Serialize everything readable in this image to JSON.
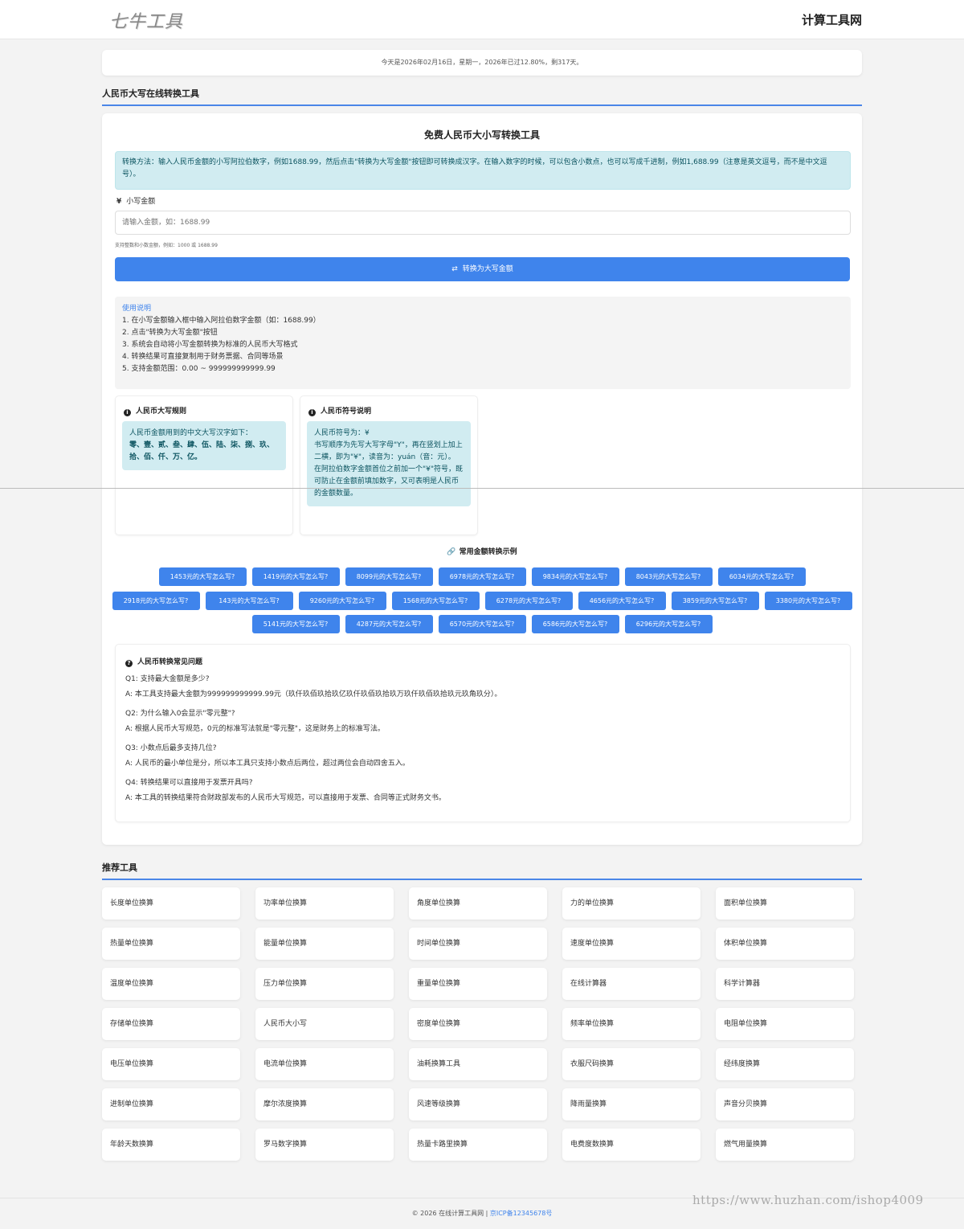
{
  "header": {
    "logo": "七牛工具",
    "site_name": "计算工具网"
  },
  "date_bar": "今天是2026年02月16日，星期一，2026年已过12.80%，剩317天。",
  "tool_section": {
    "heading": "人民币大写在线转换工具"
  },
  "converter": {
    "title": "免费人民币大小写转换工具",
    "tip": "转换方法：输入人民币金额的小写阿拉伯数字，例如1688.99，然后点击\"转换为大写金额\"按钮即可转换成汉字。在输入数字的时候，可以包含小数点，也可以写成千进制，例如1,688.99（注意是英文逗号，而不是中文逗号）。",
    "label_icon": "¥",
    "label": "小写金额",
    "placeholder": "请输入金额，如：1688.99",
    "hint": "支持整数和小数金额，例如：1000 或 1688.99",
    "button_icon": "⇄",
    "button_label": "转换为大写金额"
  },
  "usage": {
    "title": "使用说明",
    "items": [
      "1. 在小写金额输入框中输入阿拉伯数字金额（如：1688.99）",
      "2. 点击\"转换为大写金额\"按钮",
      "3. 系统会自动将小写金额转换为标准的人民币大写格式",
      "4. 转换结果可直接复制用于财务票据、合同等场景",
      "5. 支持金额范围：0.00 ~ 999999999999.99"
    ]
  },
  "rules": {
    "title": "人民币大写规则",
    "intro": "人民币金额用到的中文大写汉字如下：",
    "chars": "零、壹、贰、叁、肆、伍、陆、柒、捌、玖、拾、佰、仟、万、亿。"
  },
  "symbol": {
    "title": "人民币符号说明",
    "line1": "人民币符号为：¥",
    "line2": "书写顺序为先写大写字母\"Y\"，再在竖划上加上二横，即为\"¥\"，读音为：yuán（音：元）。",
    "line3": "在阿拉伯数字金额首位之前加一个\"¥\"符号，既可防止在金额前填加数字，又可表明是人民币的金额数量。"
  },
  "examples": {
    "icon": "🔗",
    "title": "常用金额转换示例",
    "rows": [
      [
        "1453元的大写怎么写?",
        "1419元的大写怎么写?",
        "8099元的大写怎么写?",
        "6978元的大写怎么写?",
        "9834元的大写怎么写?",
        "8043元的大写怎么写?",
        "6034元的大写怎么写?"
      ],
      [
        "2918元的大写怎么写?",
        "143元的大写怎么写?",
        "9260元的大写怎么写?",
        "1568元的大写怎么写?",
        "6278元的大写怎么写?",
        "4656元的大写怎么写?",
        "3859元的大写怎么写?",
        "3380元的大写怎么写?"
      ],
      [
        "5141元的大写怎么写?",
        "4287元的大写怎么写?",
        "6570元的大写怎么写?",
        "6586元的大写怎么写?",
        "6296元的大写怎么写?"
      ]
    ]
  },
  "faq": {
    "title": "人民币转换常见问题",
    "items": [
      {
        "q": "Q1: 支持最大金额是多少?",
        "a": "A: 本工具支持最大金额为999999999999.99元（玖仟玖佰玖拾玖亿玖仟玖佰玖拾玖万玖仟玖佰玖拾玖元玖角玖分）。"
      },
      {
        "q": "Q2: 为什么输入0会显示\"零元整\"?",
        "a": "A: 根据人民币大写规范，0元的标准写法就是\"零元整\"，这是财务上的标准写法。"
      },
      {
        "q": "Q3: 小数点后最多支持几位?",
        "a": "A: 人民币的最小单位是分，所以本工具只支持小数点后两位，超过两位会自动四舍五入。"
      },
      {
        "q": "Q4: 转换结果可以直接用于发票开具吗?",
        "a": "A: 本工具的转换结果符合财政部发布的人民币大写规范，可以直接用于发票、合同等正式财务文书。"
      }
    ]
  },
  "recommended": {
    "heading": "推荐工具",
    "tools": [
      "长度单位换算",
      "功率单位换算",
      "角度单位换算",
      "力的单位换算",
      "面积单位换算",
      "热量单位换算",
      "能量单位换算",
      "时间单位换算",
      "速度单位换算",
      "体积单位换算",
      "温度单位换算",
      "压力单位换算",
      "重量单位换算",
      "在线计算器",
      "科学计算器",
      "存储单位换算",
      "人民币大小写",
      "密度单位换算",
      "频率单位换算",
      "电阻单位换算",
      "电压单位换算",
      "电流单位换算",
      "油耗换算工具",
      "衣服尺码换算",
      "经纬度换算",
      "进制单位换算",
      "摩尔浓度换算",
      "风速等级换算",
      "降雨量换算",
      "声音分贝换算",
      "年龄天数换算",
      "罗马数字换算",
      "热量卡路里换算",
      "电费度数换算",
      "燃气用量换算"
    ]
  },
  "footer": {
    "copyright": "© 2026 在线计算工具网 | ",
    "icp": "京ICP备12345678号"
  },
  "watermark": "https://www.huzhan.com/ishop4009"
}
